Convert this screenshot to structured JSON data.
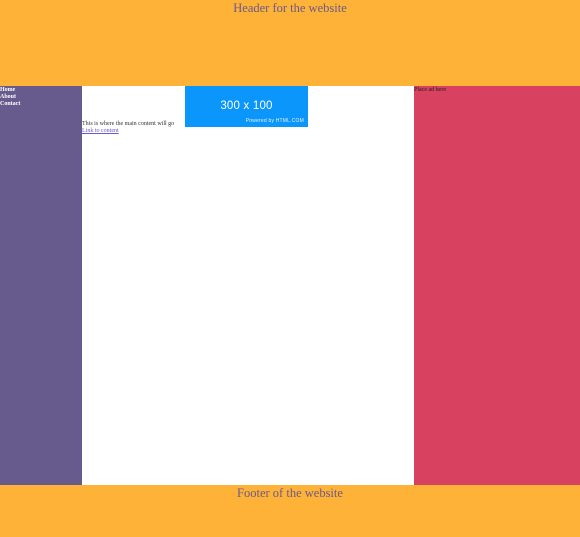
{
  "header": {
    "title": "Header for the website"
  },
  "nav": {
    "items": [
      {
        "label": "Home"
      },
      {
        "label": "About"
      },
      {
        "label": "Contact"
      }
    ]
  },
  "main": {
    "ad_banner": {
      "size_text": "300 x 100",
      "powered_text": "Powered by HTML.COM"
    },
    "content_text": "This is where the main content will go",
    "link_text": "Link to content"
  },
  "sidebar_right": {
    "ad_text": "Place ad here"
  },
  "footer": {
    "title": "Footer of the website"
  },
  "colors": {
    "header_footer": "#FEB238",
    "left_sidebar": "#675A8D",
    "right_sidebar": "#D84260",
    "ad_banner": "#0A96FA"
  }
}
